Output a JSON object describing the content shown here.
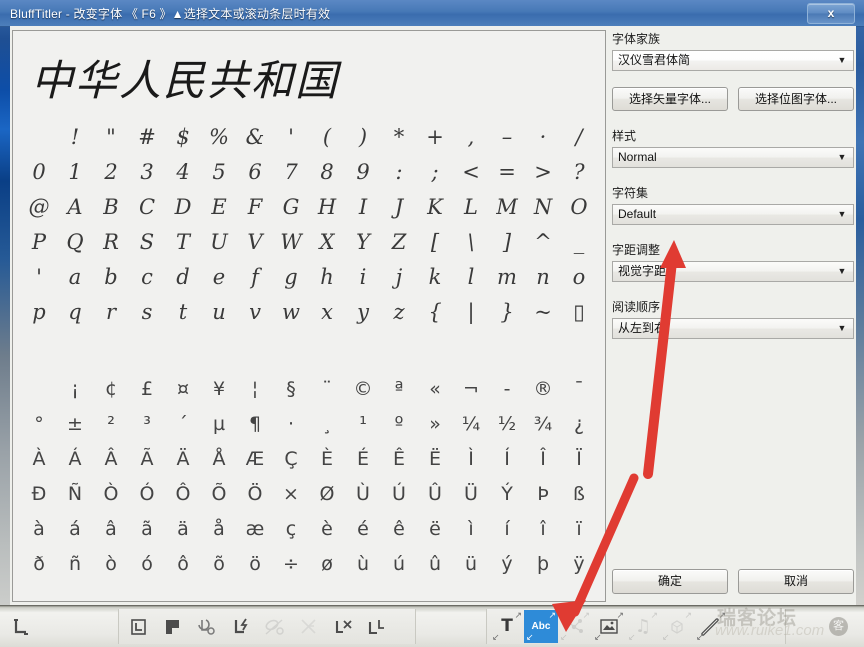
{
  "window": {
    "title": "BluffTitler - 改变字体    《 F6 》▲选择文本或滚动条层时有效",
    "close_label": "x"
  },
  "preview": {
    "sample_text": "中华人民共和国"
  },
  "charmap": {
    "rows": [
      [
        " ",
        "!",
        "\"",
        "#",
        "$",
        "%",
        "&",
        "'",
        "(",
        ")",
        "*",
        "+",
        ",",
        "–",
        "·",
        "/"
      ],
      [
        "0",
        "1",
        "2",
        "3",
        "4",
        "5",
        "6",
        "7",
        "8",
        "9",
        ":",
        ";",
        "<",
        "=",
        ">",
        "?"
      ],
      [
        "@",
        "A",
        "B",
        "C",
        "D",
        "E",
        "F",
        "G",
        "H",
        "I",
        "J",
        "K",
        "L",
        "M",
        "N",
        "O"
      ],
      [
        "P",
        "Q",
        "R",
        "S",
        "T",
        "U",
        "V",
        "W",
        "X",
        "Y",
        "Z",
        "[",
        "\\",
        "]",
        "^",
        "_"
      ],
      [
        "'",
        "a",
        "b",
        "c",
        "d",
        "e",
        "f",
        "g",
        "h",
        "i",
        "j",
        "k",
        "l",
        "m",
        "n",
        "o"
      ],
      [
        "p",
        "q",
        "r",
        "s",
        "t",
        "u",
        "v",
        "w",
        "x",
        "y",
        "z",
        "{",
        "|",
        "}",
        "~",
        "▯"
      ]
    ],
    "rows2": [
      [
        "",
        "¡",
        "¢",
        "£",
        "¤",
        "¥",
        "¦",
        "§",
        "¨",
        "©",
        "ª",
        "«",
        "¬",
        "-",
        "®",
        "¯"
      ],
      [
        "°",
        "±",
        "²",
        "³",
        "´",
        "µ",
        "¶",
        "·",
        "¸",
        "¹",
        "º",
        "»",
        "¼",
        "½",
        "¾",
        "¿"
      ],
      [
        "À",
        "Á",
        "Â",
        "Ã",
        "Ä",
        "Å",
        "Æ",
        "Ç",
        "È",
        "É",
        "Ê",
        "Ë",
        "Ì",
        "Í",
        "Î",
        "Ï"
      ],
      [
        "Ð",
        "Ñ",
        "Ò",
        "Ó",
        "Ô",
        "Õ",
        "Ö",
        "×",
        "Ø",
        "Ù",
        "Ú",
        "Û",
        "Ü",
        "Ý",
        "Þ",
        "ß"
      ],
      [
        "à",
        "á",
        "â",
        "ã",
        "ä",
        "å",
        "æ",
        "ç",
        "è",
        "é",
        "ê",
        "ë",
        "ì",
        "í",
        "î",
        "ï"
      ],
      [
        "ð",
        "ñ",
        "ò",
        "ó",
        "ô",
        "õ",
        "ö",
        "÷",
        "ø",
        "ù",
        "ú",
        "û",
        "ü",
        "ý",
        "þ",
        "ÿ"
      ]
    ]
  },
  "options": {
    "font_family_label": "字体家族",
    "font_family_value": "汉仪雪君体简",
    "vector_font_button": "选择矢量字体...",
    "bitmap_font_button": "选择位图字体...",
    "style_label": "样式",
    "style_value": "Normal",
    "charset_label": "字符集",
    "charset_value": "Default",
    "kerning_label": "字距调整",
    "kerning_value": "视觉字距",
    "reading_order_label": "阅读顺序",
    "reading_order_value": "从左到右",
    "ok_button": "确定",
    "cancel_button": "取消",
    "dropdown_arrow": "▼"
  },
  "toolbar": {
    "left_group": [
      {
        "name": "layer-move-icon",
        "glyph": "⌐"
      }
    ],
    "layer_ops": [
      {
        "name": "layer-copy-icon",
        "glyph": "⌐",
        "state": "normal"
      },
      {
        "name": "layer-paste-icon",
        "glyph": "⌐",
        "state": "normal"
      },
      {
        "name": "layer-rotate-icon",
        "glyph": "⌐",
        "state": "normal"
      },
      {
        "name": "layer-flash-icon",
        "glyph": "⌐",
        "state": "normal"
      },
      {
        "name": "layer-link-icon",
        "glyph": "⌐",
        "state": "disabled"
      },
      {
        "name": "layer-unlink-icon",
        "glyph": "⌐",
        "state": "disabled"
      },
      {
        "name": "layer-delete-icon",
        "glyph": "⌐",
        "state": "normal"
      },
      {
        "name": "layer-duplicate-icon",
        "glyph": "⌐",
        "state": "normal"
      }
    ],
    "layer_types": [
      {
        "name": "text-layer-button",
        "label": "T",
        "selected": false,
        "state": "normal"
      },
      {
        "name": "abc-text-layer-button",
        "label": "Abc",
        "selected": true,
        "state": "normal"
      },
      {
        "name": "particle-layer-button",
        "label": "",
        "selected": false,
        "state": "disabled"
      },
      {
        "name": "picture-layer-button",
        "label": "",
        "selected": false,
        "state": "normal"
      },
      {
        "name": "audio-layer-button",
        "label": "",
        "selected": false,
        "state": "disabled"
      },
      {
        "name": "model-layer-button",
        "label": "",
        "selected": false,
        "state": "disabled"
      },
      {
        "name": "effect-layer-button",
        "label": "",
        "selected": false,
        "state": "normal"
      }
    ],
    "corner_arrow_tr": "↗",
    "corner_arrow_bl": "↙"
  },
  "watermark": {
    "site_cn": "瑞客论坛",
    "site_url": "www.ruike1.com",
    "badge": "客"
  }
}
